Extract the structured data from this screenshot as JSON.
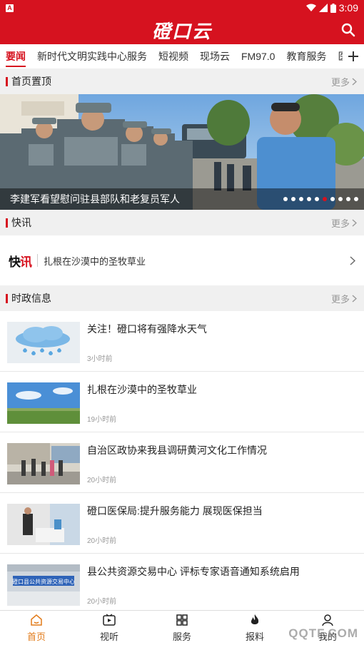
{
  "statusbar": {
    "time": "3:09"
  },
  "app": {
    "title": "磴口云"
  },
  "tabs": [
    {
      "label": "要闻"
    },
    {
      "label": "新时代文明实践中心服务"
    },
    {
      "label": "短视频"
    },
    {
      "label": "现场云"
    },
    {
      "label": "FM97.0"
    },
    {
      "label": "教育服务"
    },
    {
      "label": "医"
    }
  ],
  "top_section": {
    "title": "首页置顶",
    "more": "更多"
  },
  "banner": {
    "caption": "李建军看望慰问驻县部队和老复员军人",
    "slide_count": 10,
    "active_slide": 6
  },
  "flash_section": {
    "title": "快讯",
    "more": "更多"
  },
  "flash": {
    "logo_a": "快",
    "logo_b": "讯",
    "text": "扎根在沙漠中的圣牧草业"
  },
  "politics_section": {
    "title": "时政信息",
    "more": "更多"
  },
  "news": [
    {
      "title": "关注！磴口将有强降水天气",
      "time": "3小时前",
      "thumb": "rain-cloud"
    },
    {
      "title": "扎根在沙漠中的圣牧草业",
      "time": "19小时前",
      "thumb": "grassland"
    },
    {
      "title": "自治区政协来我县调研黄河文化工作情况",
      "time": "20小时前",
      "thumb": "visit"
    },
    {
      "title": "磴口医保局:提升服务能力 展现医保担当",
      "time": "20小时前",
      "thumb": "service"
    },
    {
      "title": "县公共资源交易中心 评标专家语音通知系统启用",
      "time": "20小时前",
      "thumb": "office",
      "thumb_sign": "磴口县公共资源交易中心"
    }
  ],
  "bottomnav": [
    {
      "label": "首页",
      "icon": "home-icon"
    },
    {
      "label": "视听",
      "icon": "video-icon"
    },
    {
      "label": "服务",
      "icon": "grid-icon"
    },
    {
      "label": "报料",
      "icon": "fire-icon"
    },
    {
      "label": "我的",
      "icon": "user-icon"
    }
  ],
  "watermark": "QQTF.COM",
  "colors": {
    "brand": "#d6121f",
    "nav_active": "#e27b1a"
  }
}
